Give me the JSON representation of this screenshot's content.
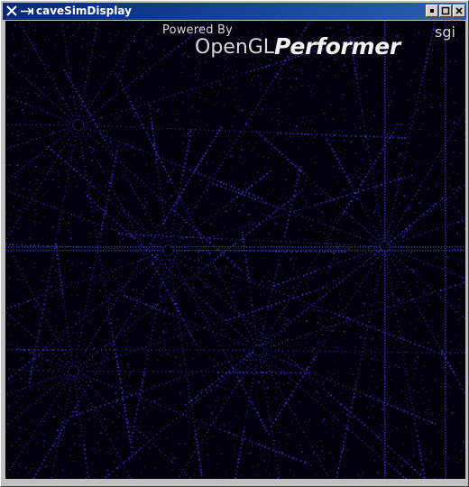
{
  "window": {
    "title": "caveSimDisplay",
    "buttons": [
      "minimize",
      "maximize",
      "close"
    ],
    "app_icon": "x-icon",
    "title_bar_color": "#0a2a78"
  },
  "viewport": {
    "background": "#02010c",
    "point_color": "#3a36d8",
    "overlay": {
      "powered_by": "Powered By",
      "opengl": "OpenGL",
      "performer": "Performer",
      "sgi": "sgi"
    }
  }
}
